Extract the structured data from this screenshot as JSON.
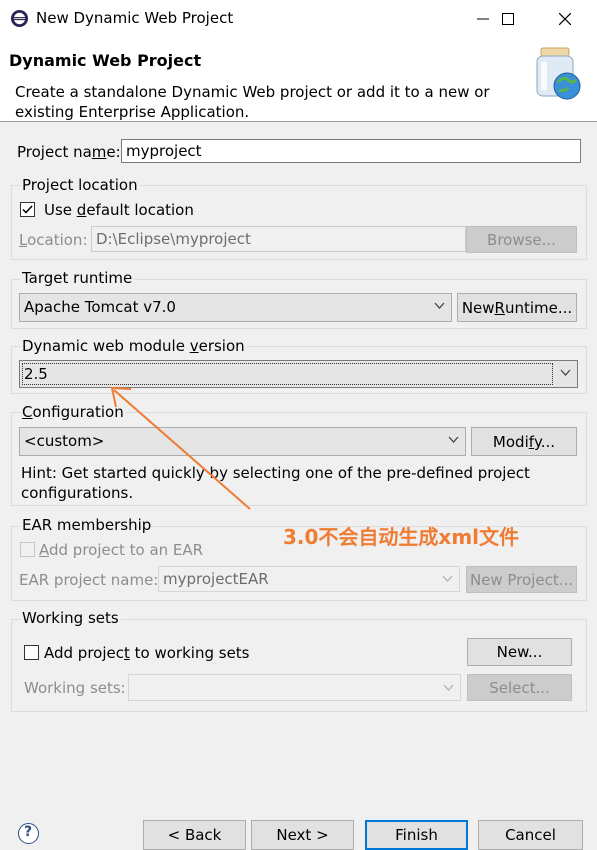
{
  "window": {
    "title": "New Dynamic Web Project"
  },
  "header": {
    "title": "Dynamic Web Project",
    "description_line1": "Create a standalone Dynamic Web project or add it to a new or",
    "description_line2": "existing Enterprise Application."
  },
  "project_name": {
    "label_pre": "Project na",
    "label_u": "m",
    "label_post": "e:",
    "value": "myproject"
  },
  "project_location": {
    "group_label": "Project location",
    "use_default_pre": "Use ",
    "use_default_u": "d",
    "use_default_post": "efault location",
    "use_default_checked": true,
    "location_label_pre": "",
    "location_label_u": "L",
    "location_label_post": "ocation:",
    "location_value": "D:\\Eclipse\\myproject",
    "browse_label": "Browse..."
  },
  "target_runtime": {
    "group_label": "Target runtime",
    "selected": "Apache Tomcat v7.0",
    "new_runtime_pre": "New ",
    "new_runtime_u": "R",
    "new_runtime_post": "untime..."
  },
  "module_version": {
    "group_label_pre": "Dynamic web module ",
    "group_label_u": "v",
    "group_label_post": "ersion",
    "selected": "2.5"
  },
  "configuration": {
    "group_label_pre": "",
    "group_label_u": "C",
    "group_label_post": "onfiguration",
    "selected": "<custom>",
    "modify_pre": "Modi",
    "modify_u": "f",
    "modify_post": "y...",
    "hint_line1": "Hint: Get started quickly by selecting one of the pre-defined project",
    "hint_line2": "configurations."
  },
  "ear": {
    "group_label": "EAR membership",
    "add_pre": "",
    "add_u": "A",
    "add_post": "dd project to an EAR",
    "ear_name_label": "EAR project name:",
    "ear_name_value": "myprojectEAR",
    "new_project_label": "New Project..."
  },
  "working_sets": {
    "group_label": "Working sets",
    "add_pre": "Add projec",
    "add_u": "t",
    "add_post": " to working sets",
    "new_label": "New...",
    "ws_label": "Working sets:",
    "select_label": "Select..."
  },
  "annotation": {
    "text": "3.0不会自动生成xml文件",
    "color": "#f07c34"
  },
  "footer": {
    "back_label": "< Back",
    "next_label": "Next >",
    "finish_label": "Finish",
    "cancel_label": "Cancel"
  }
}
